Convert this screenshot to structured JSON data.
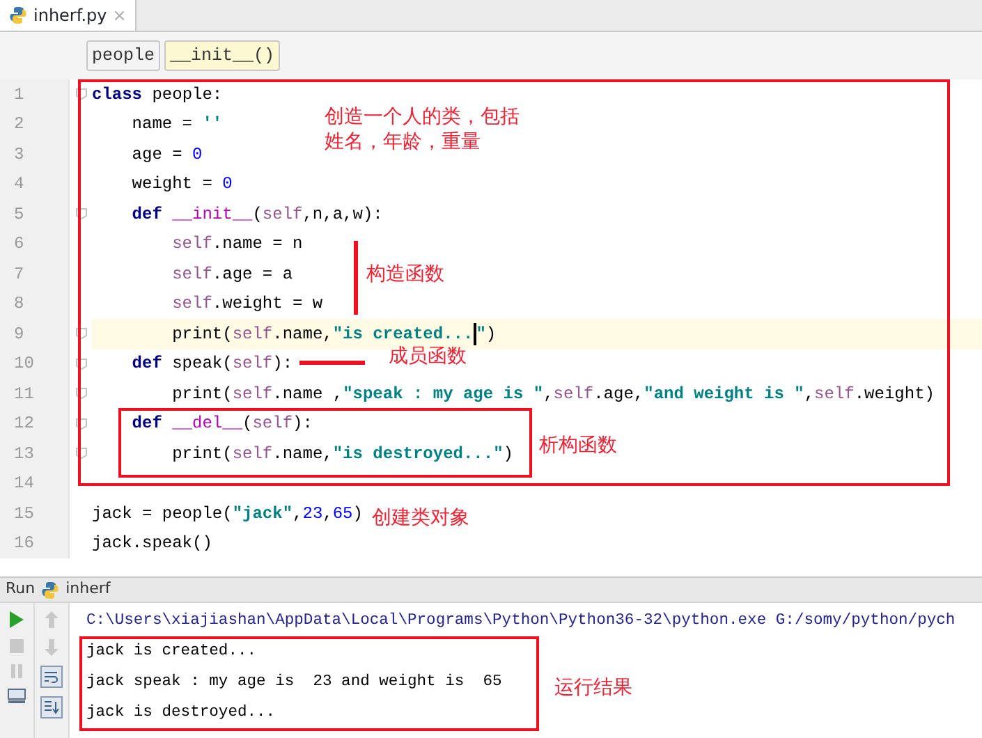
{
  "tab": {
    "title": "inherf.py",
    "close": "×"
  },
  "breadcrumbs": [
    {
      "label": "people",
      "selected": false
    },
    {
      "label": "__init__()",
      "selected": true
    }
  ],
  "code_lines": [
    {
      "number": "1",
      "fold": true,
      "highlighted": false,
      "tokens": [
        {
          "kind": "kw",
          "text": "class"
        },
        {
          "kind": "plain",
          "text": " people:"
        }
      ],
      "children": [
        {
          "number": "2",
          "fold": false,
          "highlighted": false,
          "tokens": [
            {
              "kind": "plain",
              "text": "name = "
            },
            {
              "kind": "str",
              "text": "''"
            }
          ]
        },
        {
          "number": "3",
          "fold": false,
          "highlighted": false,
          "tokens": [
            {
              "kind": "plain",
              "text": "age = "
            },
            {
              "kind": "num",
              "text": "0"
            }
          ]
        },
        {
          "number": "4",
          "fold": false,
          "highlighted": false,
          "tokens": [
            {
              "kind": "plain",
              "text": "weight = "
            },
            {
              "kind": "num",
              "text": "0"
            }
          ]
        },
        {
          "number": "5",
          "fold": true,
          "highlighted": false,
          "tokens": [
            {
              "kind": "kw",
              "text": "def"
            },
            {
              "kind": "magic",
              "text": " __init__"
            },
            {
              "kind": "plain",
              "text": "("
            },
            {
              "kind": "self",
              "text": "self"
            },
            {
              "kind": "plain",
              "text": ",n,a,w):"
            }
          ],
          "children": [
            {
              "number": "6",
              "fold": false,
              "highlighted": false,
              "tokens": [
                {
                  "kind": "self",
                  "text": "self"
                },
                {
                  "kind": "plain",
                  "text": ".name = n"
                }
              ]
            },
            {
              "number": "7",
              "fold": false,
              "highlighted": false,
              "tokens": [
                {
                  "kind": "self",
                  "text": "self"
                },
                {
                  "kind": "plain",
                  "text": ".age = a"
                }
              ]
            },
            {
              "number": "8",
              "fold": false,
              "highlighted": false,
              "tokens": [
                {
                  "kind": "self",
                  "text": "self"
                },
                {
                  "kind": "plain",
                  "text": ".weight = w"
                }
              ]
            },
            {
              "number": "9",
              "fold": true,
              "highlighted": true,
              "tokens": [
                {
                  "kind": "plain",
                  "text": "print("
                },
                {
                  "kind": "self",
                  "text": "self"
                },
                {
                  "kind": "plain",
                  "text": ".name,"
                },
                {
                  "kind": "str",
                  "text": "\"is created..."
                },
                {
                  "kind": "caret"
                },
                {
                  "kind": "str",
                  "text": "\""
                },
                {
                  "kind": "plain",
                  "text": ")"
                }
              ]
            }
          ]
        },
        {
          "number": "10",
          "fold": true,
          "highlighted": false,
          "tokens": [
            {
              "kind": "kw",
              "text": "def"
            },
            {
              "kind": "plain",
              "text": " speak("
            },
            {
              "kind": "self",
              "text": "self"
            },
            {
              "kind": "plain",
              "text": "):"
            }
          ],
          "children": [
            {
              "number": "11",
              "fold": true,
              "highlighted": false,
              "tokens": [
                {
                  "kind": "plain",
                  "text": "print("
                },
                {
                  "kind": "self",
                  "text": "self"
                },
                {
                  "kind": "plain",
                  "text": ".name ,"
                },
                {
                  "kind": "str",
                  "text": "\"speak : my age is \""
                },
                {
                  "kind": "plain",
                  "text": ","
                },
                {
                  "kind": "self",
                  "text": "self"
                },
                {
                  "kind": "plain",
                  "text": ".age,"
                },
                {
                  "kind": "str",
                  "text": "\"and weight is \""
                },
                {
                  "kind": "plain",
                  "text": ","
                },
                {
                  "kind": "self",
                  "text": "self"
                },
                {
                  "kind": "plain",
                  "text": ".weight)"
                }
              ]
            }
          ]
        },
        {
          "number": "12",
          "fold": true,
          "highlighted": false,
          "tokens": [
            {
              "kind": "kw",
              "text": "def"
            },
            {
              "kind": "magic",
              "text": " __del__"
            },
            {
              "kind": "plain",
              "text": "("
            },
            {
              "kind": "self",
              "text": "self"
            },
            {
              "kind": "plain",
              "text": "):"
            }
          ],
          "children": [
            {
              "number": "13",
              "fold": true,
              "highlighted": false,
              "tokens": [
                {
                  "kind": "plain",
                  "text": "print("
                },
                {
                  "kind": "self",
                  "text": "self"
                },
                {
                  "kind": "plain",
                  "text": ".name,"
                },
                {
                  "kind": "str",
                  "text": "\"is destroyed...\""
                },
                {
                  "kind": "plain",
                  "text": ")"
                }
              ]
            }
          ]
        }
      ]
    },
    {
      "number": "14",
      "fold": false,
      "highlighted": false
    },
    {
      "number": "15",
      "fold": false,
      "highlighted": false,
      "tokens": [
        {
          "kind": "plain",
          "text": "jack = people("
        },
        {
          "kind": "str",
          "text": "\"jack\""
        },
        {
          "kind": "plain",
          "text": ","
        },
        {
          "kind": "num",
          "text": "23"
        },
        {
          "kind": "plain",
          "text": ","
        },
        {
          "kind": "num",
          "text": "65"
        },
        {
          "kind": "plain",
          "text": ")"
        }
      ]
    },
    {
      "number": "16",
      "fold": false,
      "highlighted": false,
      "tokens": [
        {
          "kind": "plain",
          "text": "jack.speak()"
        }
      ]
    }
  ],
  "run_panel": {
    "title": "Run",
    "config": "inherf",
    "lines": [
      {
        "kind": "command",
        "text": "C:\\Users\\xiajiashan\\AppData\\Local\\Programs\\Python\\Python36-32\\python.exe G:/somy/python/pych"
      },
      {
        "kind": "output",
        "text": "jack is created..."
      },
      {
        "kind": "output",
        "text": "jack speak : my age is  23 and weight is  65"
      },
      {
        "kind": "output",
        "text": "jack is destroyed..."
      }
    ]
  },
  "annotations": [
    "创造一个人的类，包括姓名，年龄，重量",
    "构造函数",
    "成员函数",
    "析构函数",
    "创建类对象",
    "运行结果"
  ]
}
